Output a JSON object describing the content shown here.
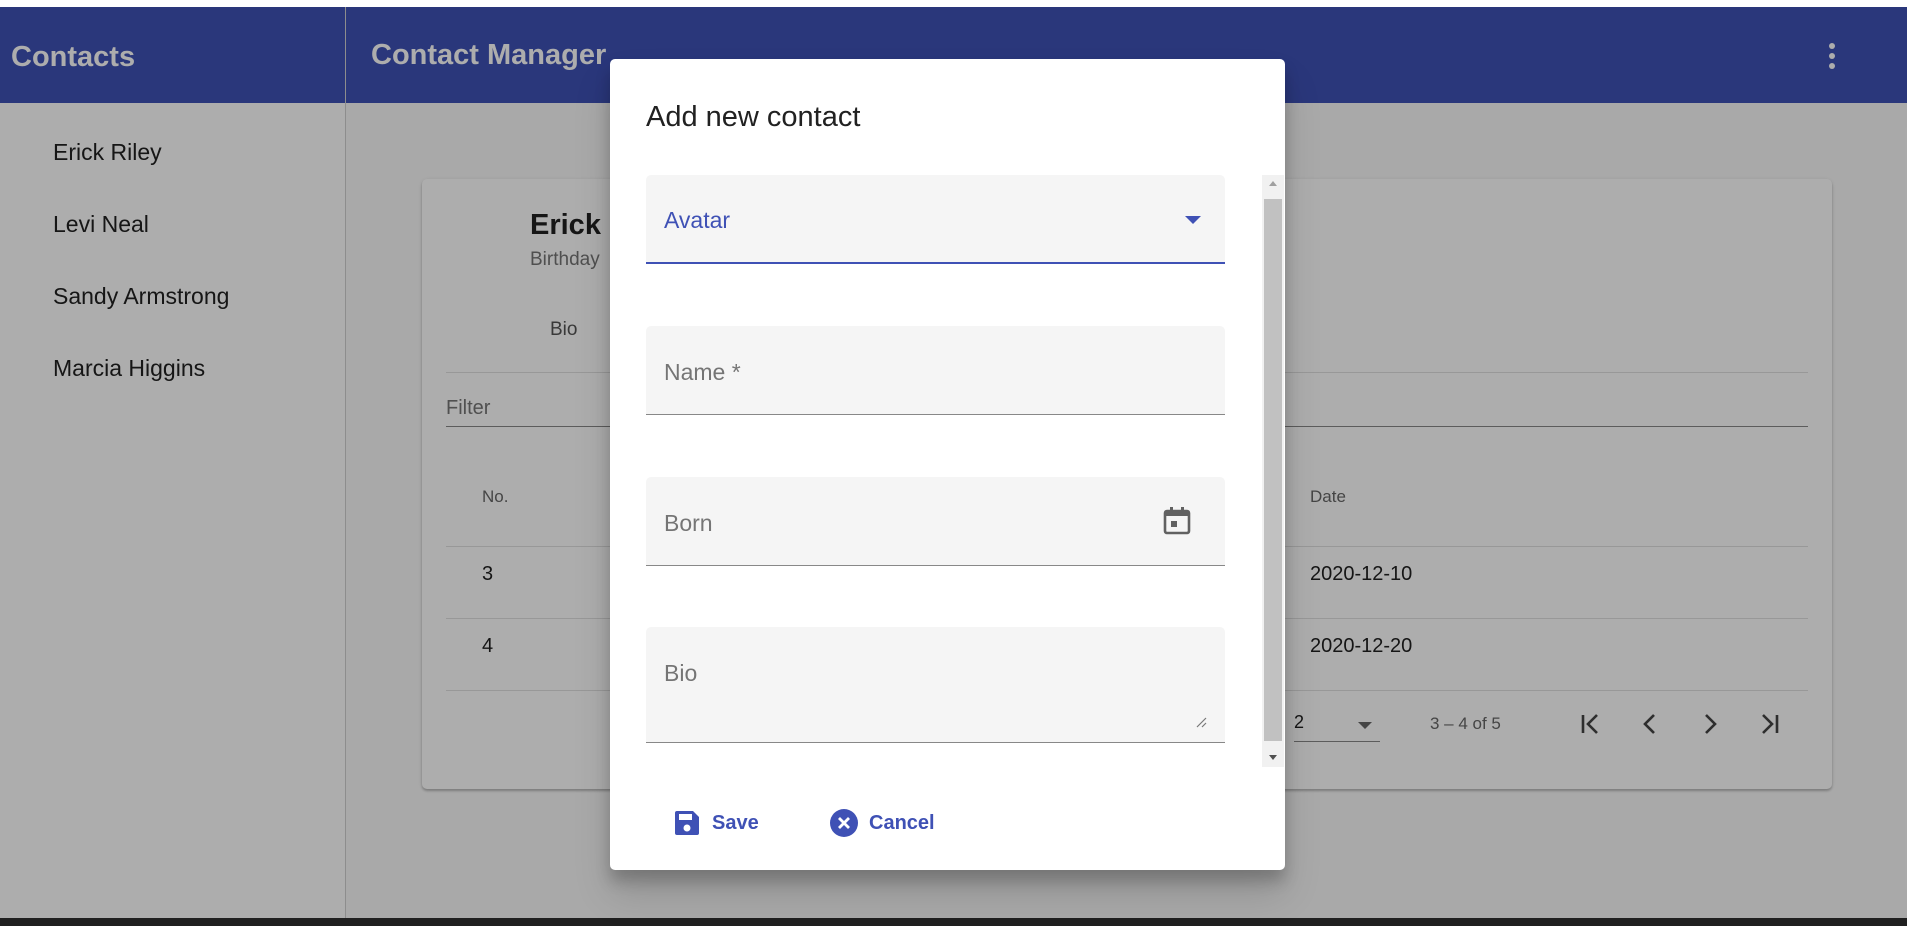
{
  "sidebar": {
    "title": "Contacts",
    "items": [
      {
        "label": "Erick Riley"
      },
      {
        "label": "Levi Neal"
      },
      {
        "label": "Sandy Armstrong"
      },
      {
        "label": "Marcia Higgins"
      }
    ]
  },
  "toolbar": {
    "title": "Contact Manager",
    "menu_icon": "more-vert-icon"
  },
  "card": {
    "title": "Erick I",
    "subtitle": "Birthday",
    "tab": "Bio",
    "filter_label": "Filter",
    "columns": [
      "No.",
      "Date"
    ],
    "rows": [
      {
        "no": "3",
        "date": "2020-12-10"
      },
      {
        "no": "4",
        "date": "2020-12-20"
      }
    ],
    "paginator": {
      "page_size": "2",
      "range": "3 – 4 of 5"
    }
  },
  "dialog": {
    "title": "Add new contact",
    "fields": {
      "avatar": "Avatar",
      "name": "Name *",
      "born": "Born",
      "bio": "Bio"
    },
    "actions": {
      "save": "Save",
      "cancel": "Cancel"
    }
  },
  "colors": {
    "primary": "#3f51b5"
  }
}
